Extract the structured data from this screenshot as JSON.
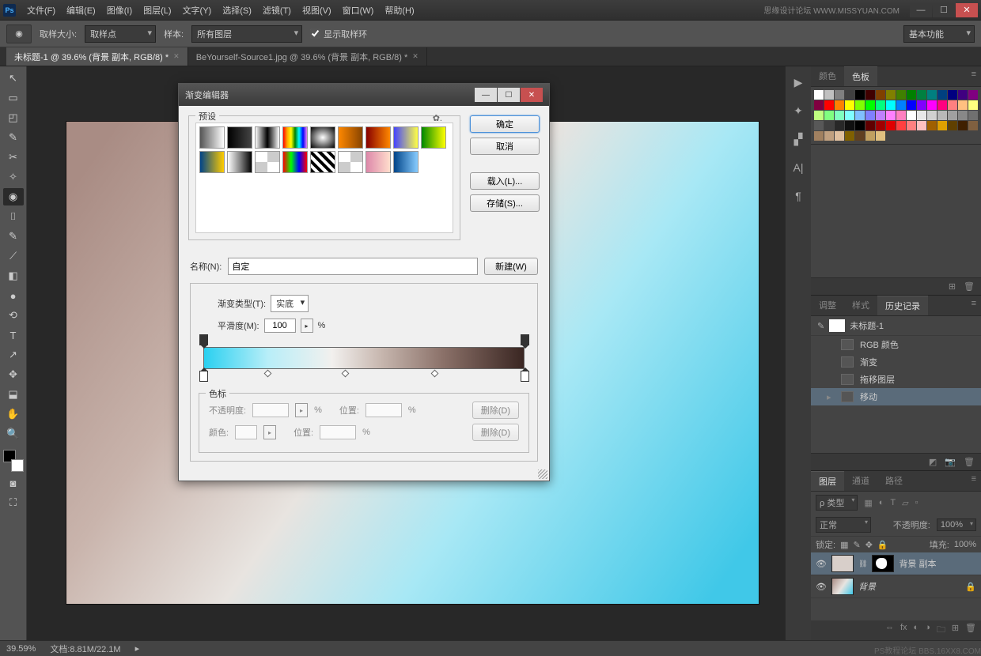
{
  "titlebar": {
    "brand": "思缘设计论坛  WWW.MISSYUAN.COM",
    "menus": [
      "文件(F)",
      "编辑(E)",
      "图像(I)",
      "图层(L)",
      "文字(Y)",
      "选择(S)",
      "滤镜(T)",
      "视图(V)",
      "窗口(W)",
      "帮助(H)"
    ]
  },
  "optbar": {
    "sample_size_label": "取样大小:",
    "sample_size_value": "取样点",
    "sample_label": "样本:",
    "sample_value": "所有图层",
    "show_ring": "显示取样环",
    "workspace": "基本功能"
  },
  "tabs": [
    {
      "label": "未标题-1 @ 39.6% (背景 副本, RGB/8) *",
      "active": true
    },
    {
      "label": "BeYourself-Source1.jpg @ 39.6% (背景 副本, RGB/8) *",
      "active": false
    }
  ],
  "tools": [
    "↖",
    "▭",
    "◰",
    "✎",
    "✂",
    "✧",
    "◉",
    "⌷",
    "✎",
    "⟋",
    "◧",
    "●",
    "⟲",
    "T",
    "↗",
    "✥",
    "⬓",
    "✋",
    "🔍"
  ],
  "status": {
    "zoom": "39.59%",
    "doc": "文档:8.81M/22.1M"
  },
  "swatches_panel": {
    "tab1": "颜色",
    "tab2": "色板"
  },
  "history_panel": {
    "tabs": [
      "调整",
      "样式",
      "历史记录"
    ],
    "doc": "未标题-1",
    "items": [
      "RGB 颜色",
      "渐变",
      "拖移图层",
      "移动"
    ]
  },
  "layers_panel": {
    "tabs": [
      "图层",
      "通道",
      "路径"
    ],
    "kind": "ρ 类型",
    "blend": "正常",
    "opacity_label": "不透明度:",
    "opacity_val": "100%",
    "lock_label": "锁定:",
    "fill_label": "填充:",
    "fill_val": "100%",
    "layers": [
      {
        "name": "背景 副本",
        "sel": true,
        "mask": true,
        "locked": false
      },
      {
        "name": "背景",
        "sel": false,
        "mask": false,
        "locked": true,
        "italic": true
      }
    ]
  },
  "dialog": {
    "title": "渐变编辑器",
    "presets_label": "预设",
    "ok": "确定",
    "cancel": "取消",
    "load": "载入(L)...",
    "save": "存储(S)...",
    "name_label": "名称(N):",
    "name_value": "自定",
    "new_btn": "新建(W)",
    "type_label": "渐变类型(T):",
    "type_value": "实底",
    "smooth_label": "平滑度(M):",
    "smooth_value": "100",
    "stops_label": "色标",
    "opacity_label": "不透明度:",
    "position_label": "位置:",
    "color_label": "颜色:",
    "delete": "删除(D)"
  },
  "swatch_colors": [
    "#ffffff",
    "#c0c0c0",
    "#808080",
    "#404040",
    "#000000",
    "#400000",
    "#804000",
    "#808000",
    "#408000",
    "#008000",
    "#008040",
    "#008080",
    "#004080",
    "#000080",
    "#400080",
    "#800080",
    "#800040",
    "#ff0000",
    "#ff8000",
    "#ffff00",
    "#80ff00",
    "#00ff00",
    "#00ff80",
    "#00ffff",
    "#0080ff",
    "#0000ff",
    "#8000ff",
    "#ff00ff",
    "#ff0080",
    "#ff8080",
    "#ffc080",
    "#ffff80",
    "#c0ff80",
    "#80ff80",
    "#80ffc0",
    "#80ffff",
    "#80c0ff",
    "#8080ff",
    "#c080ff",
    "#ff80ff",
    "#ff80c0",
    "#ffffff",
    "#e8e8e8",
    "#d0d0d0",
    "#b8b8b8",
    "#a0a0a0",
    "#888888",
    "#707070",
    "#585858",
    "#404040",
    "#282828",
    "#101010",
    "#000000",
    "#600000",
    "#a00000",
    "#e00000",
    "#ff4040",
    "#ff8080",
    "#ffc0c0",
    "#a06000",
    "#e0a000",
    "#604000",
    "#402000",
    "#806040",
    "#a08060",
    "#c0a080",
    "#e0c0a0",
    "#806000",
    "#604020",
    "#c0a060",
    "#e0c080"
  ],
  "presets": [
    "linear-gradient(90deg,#555,#fff)",
    "linear-gradient(90deg,#000,#444)",
    "linear-gradient(90deg,#fff,#000,#fff)",
    "linear-gradient(90deg,red,orange,yellow,green,cyan,blue,violet)",
    "radial-gradient(#fff,#000)",
    "linear-gradient(90deg,#f80,#840)",
    "linear-gradient(90deg,#800,#f80)",
    "linear-gradient(90deg,#44f,#ff4)",
    "linear-gradient(90deg,#080,#ff0)",
    "linear-gradient(90deg,#048,#fc0)",
    "linear-gradient(90deg,#fff,#888,#000)",
    "repeating-conic-gradient(#ccc 0 25%,#fff 0 50%)",
    "linear-gradient(90deg,red,lime,blue,red)",
    "repeating-linear-gradient(45deg,#000 0 4px,#fff 4px 8px)",
    "repeating-conic-gradient(#ccc 0 25%,#fff 0 50%)",
    "linear-gradient(90deg,#d8a,#fdc)",
    "linear-gradient(90deg,#048,#8cf)"
  ],
  "stops": {
    "op": [
      0,
      100
    ],
    "cl": [
      0,
      100
    ],
    "mid": [
      20,
      44,
      72
    ]
  },
  "watermarks": {
    "bottom": "PS教程论坛  BBS.16XX8.COM"
  }
}
